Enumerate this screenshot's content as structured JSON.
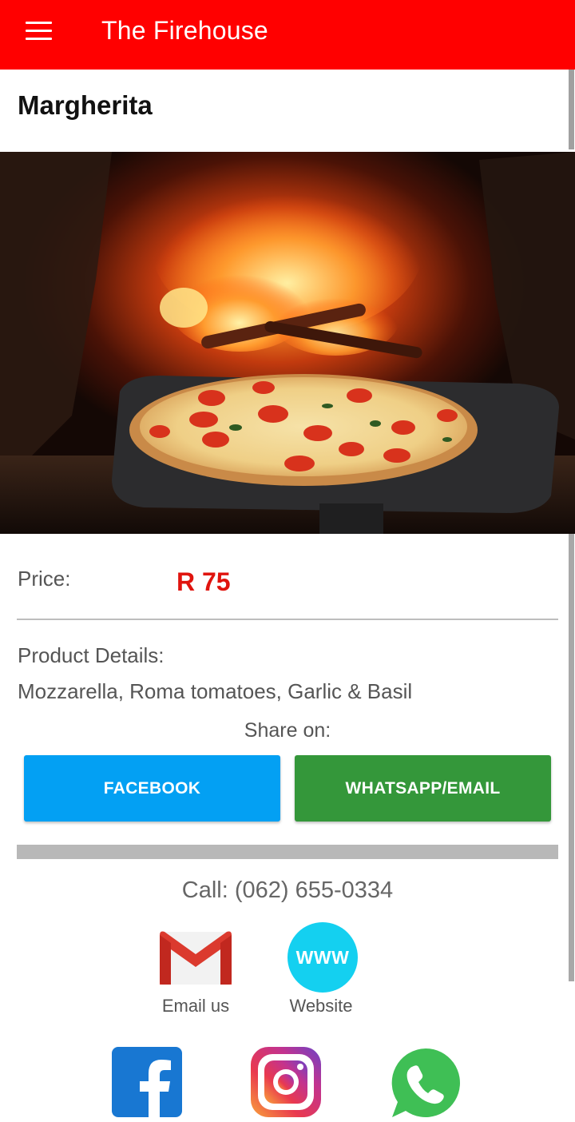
{
  "appbar": {
    "title": "The Firehouse",
    "menu_icon": "hamburger-menu-icon",
    "color": "#ff0000"
  },
  "item": {
    "title": "Margherita",
    "image_alt": "Margherita pizza on a peel in front of a wood-fired oven",
    "price_label": "Price:",
    "price": "R 75",
    "details_label": "Product Details:",
    "details": "Mozzarella, Roma tomatoes, Garlic & Basil"
  },
  "share": {
    "label": "Share on:",
    "facebook_label": "FACEBOOK",
    "whatsapp_label": "WHATSAPP/EMAIL",
    "facebook_color": "#03a0f3",
    "whatsapp_color": "#34973a"
  },
  "contact": {
    "call": "Call: (062) 655-0334",
    "email_label": "Email us",
    "website_label": "Website",
    "website_icon_text": "WWW",
    "email_icon": "gmail-icon",
    "website_icon": "www-globe-icon"
  },
  "social": {
    "icons": [
      "facebook-icon",
      "instagram-icon",
      "whatsapp-icon"
    ]
  }
}
